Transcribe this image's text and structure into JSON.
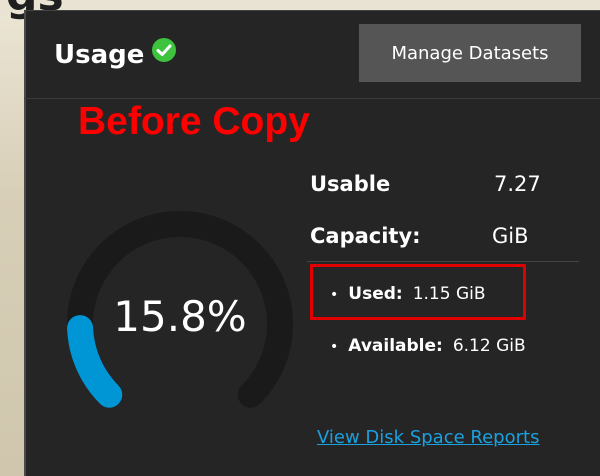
{
  "card": {
    "title": "Usage",
    "status_icon": "check-circle-icon",
    "manage_button": "Manage Datasets"
  },
  "annotation": {
    "label": "Before Copy",
    "color": "#ff0000"
  },
  "usage_gauge": {
    "percent_text": "15.8%",
    "used_fraction": 0.158,
    "fill_color": "#0095d5",
    "track_color": "#1a1a1a"
  },
  "capacity": {
    "label_line1": "Usable",
    "label_line2": "Capacity:",
    "value_line1": "7.27",
    "value_line2": "GiB"
  },
  "details": {
    "used_label": "Used:",
    "used_value": "1.15 GiB",
    "available_label": "Available:",
    "available_value": "6.12 GiB"
  },
  "reports_link": "View Disk Space Reports",
  "colors": {
    "card_bg": "#252525",
    "button_bg": "#555555",
    "link": "#1aa1e0",
    "check_green": "#3ec33e"
  }
}
